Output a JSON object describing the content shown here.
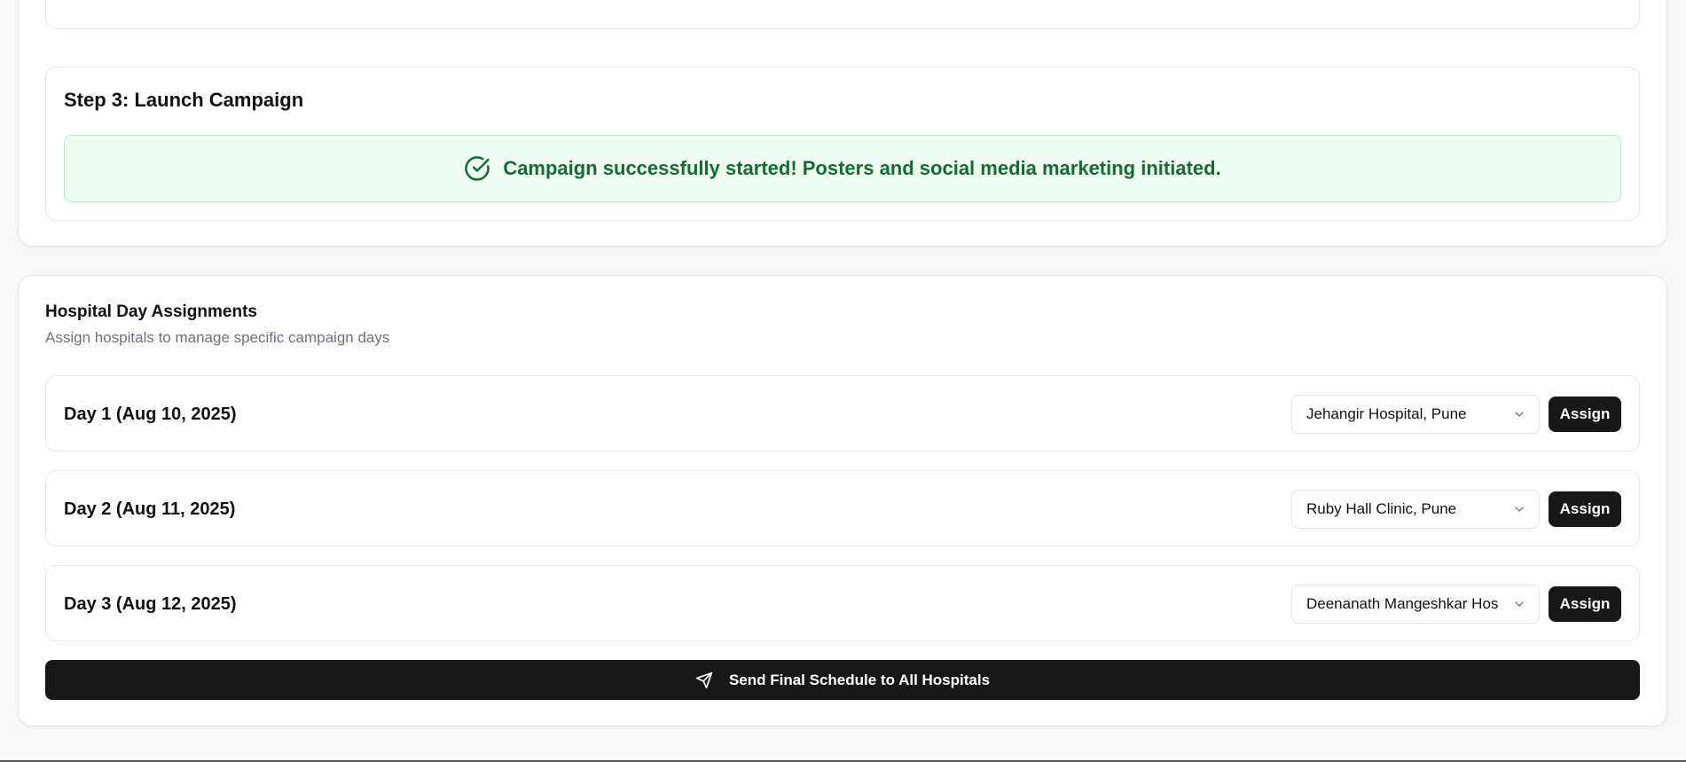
{
  "step3": {
    "title": "Step 3: Launch Campaign",
    "success_message": "Campaign successfully started! Posters and social media marketing initiated."
  },
  "hospital_assignments": {
    "title": "Hospital Day Assignments",
    "subtitle": "Assign hospitals to manage specific campaign days",
    "days": [
      {
        "label": "Day 1 (Aug 10, 2025)",
        "selected_hospital": "Jehangir Hospital, Pune",
        "assign_label": "Assign"
      },
      {
        "label": "Day 2 (Aug 11, 2025)",
        "selected_hospital": "Ruby Hall Clinic, Pune",
        "assign_label": "Assign"
      },
      {
        "label": "Day 3 (Aug 12, 2025)",
        "selected_hospital": "Deenanath Mangeshkar Hos",
        "assign_label": "Assign"
      }
    ],
    "send_button_label": "Send Final Schedule to All Hospitals"
  },
  "colors": {
    "success_bg": "#effdf3",
    "success_text": "#146b34",
    "primary_button": "#18181b",
    "highlight_border": "#e0343f"
  },
  "icons": {
    "success": "check-circle-icon",
    "dropdown": "chevron-down-icon",
    "send": "send-icon"
  }
}
